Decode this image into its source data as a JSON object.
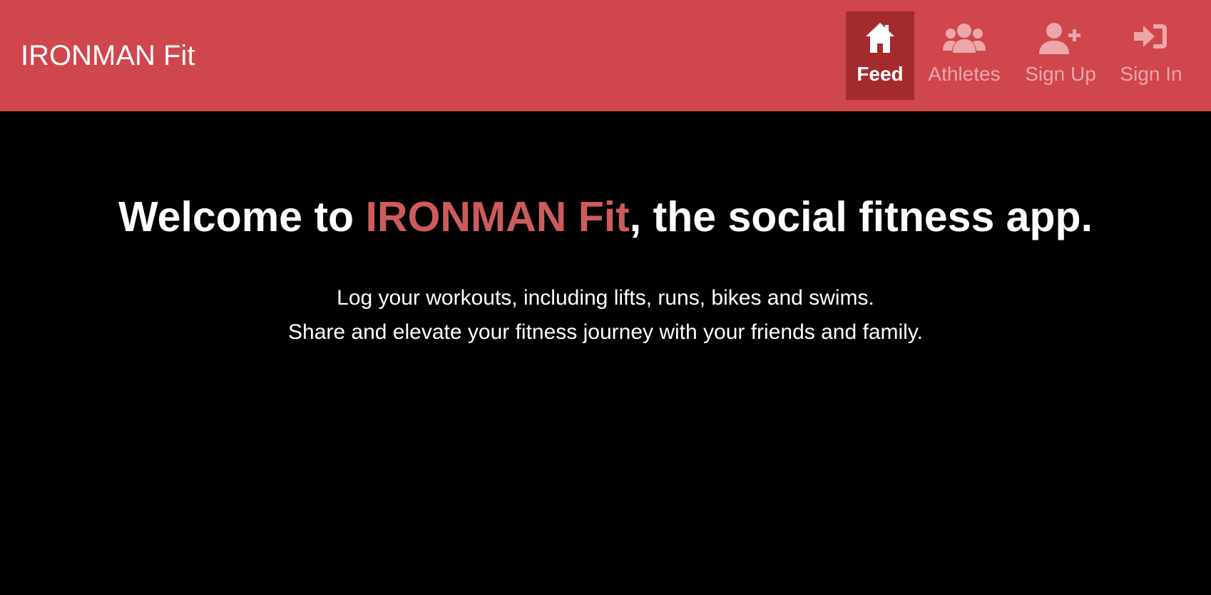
{
  "brand": "IRONMAN Fit",
  "colors": {
    "navbar": "#cf464d",
    "active_tab": "#a32b2d",
    "muted_label": "#eda6aa",
    "accent_text": "#cd5c5c",
    "background": "#000000"
  },
  "nav": {
    "items": [
      {
        "label": "Feed",
        "icon": "home-icon",
        "active": true
      },
      {
        "label": "Athletes",
        "icon": "users-icon",
        "active": false
      },
      {
        "label": "Sign Up",
        "icon": "user-plus-icon",
        "active": false
      },
      {
        "label": "Sign In",
        "icon": "sign-in-icon",
        "active": false
      }
    ]
  },
  "hero": {
    "title_before": "Welcome to ",
    "title_accent": "IRONMAN Fit",
    "title_after": ", the social fitness app.",
    "line1": "Log your workouts, including lifts, runs, bikes and swims.",
    "line2": "Share and elevate your fitness journey with your friends and family."
  }
}
